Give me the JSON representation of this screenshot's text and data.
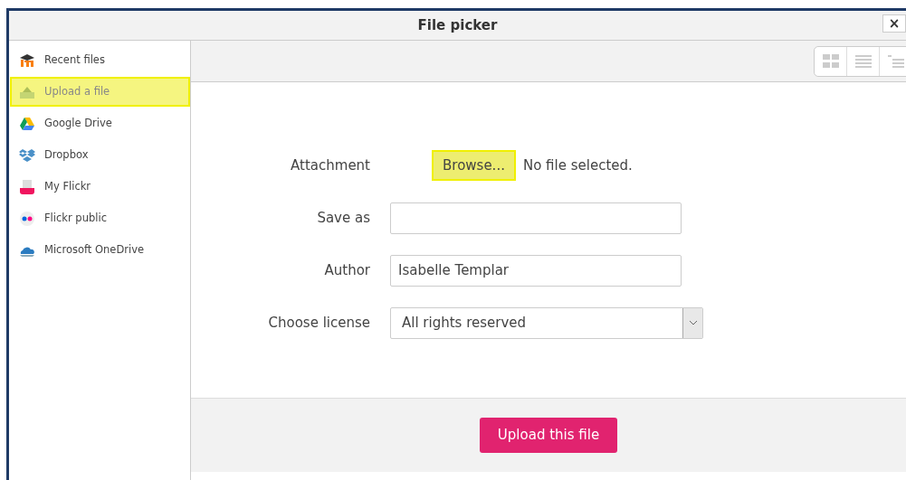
{
  "window": {
    "title": "File picker",
    "close": "×"
  },
  "sidebar": {
    "items": [
      {
        "label": "Recent files",
        "kind": "recent",
        "selected": false
      },
      {
        "label": "Upload a file",
        "kind": "upload",
        "selected": true
      },
      {
        "label": "Google Drive",
        "kind": "drive",
        "selected": false
      },
      {
        "label": "Dropbox",
        "kind": "dropbox",
        "selected": false
      },
      {
        "label": "My Flickr",
        "kind": "flickr",
        "selected": false
      },
      {
        "label": "Flickr public",
        "kind": "flickr-public",
        "selected": false
      },
      {
        "label": "Microsoft OneDrive",
        "kind": "onedrive",
        "selected": false
      }
    ]
  },
  "form": {
    "fields": [
      {
        "kind": "file",
        "label": "Attachment",
        "button": "Browse...",
        "highlighted": true,
        "status": "No file selected."
      },
      {
        "kind": "text",
        "label": "Save as"
      },
      {
        "kind": "text",
        "label": "Author",
        "value": "Isabelle Templar"
      },
      {
        "kind": "select",
        "label": "Choose license",
        "value": "All rights reserved"
      }
    ]
  },
  "footer": {
    "button": "Upload this file"
  }
}
